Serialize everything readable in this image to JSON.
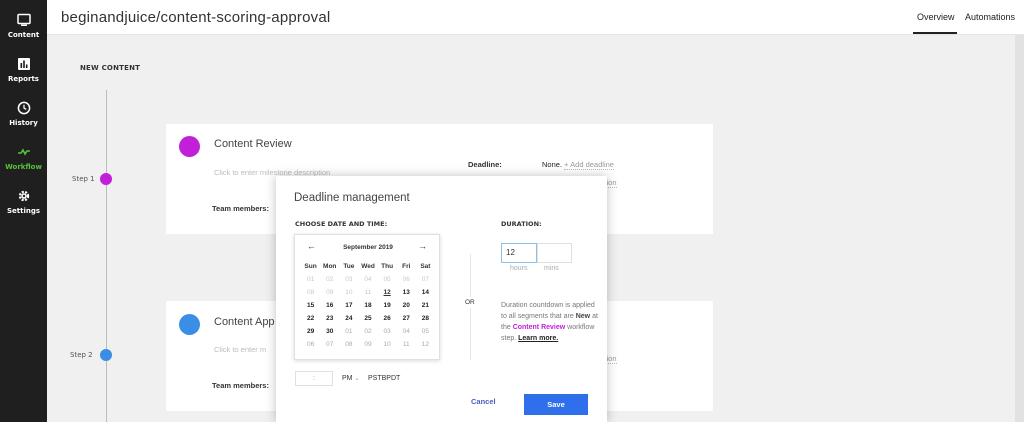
{
  "sidebar": {
    "items": [
      {
        "label": "Content",
        "icon": "monitor-icon"
      },
      {
        "label": "Reports",
        "icon": "bar-chart-icon"
      },
      {
        "label": "History",
        "icon": "clock-icon"
      },
      {
        "label": "Workflow",
        "icon": "workflow-icon",
        "active": true
      },
      {
        "label": "Settings",
        "icon": "gear-icon"
      }
    ]
  },
  "header": {
    "title": "beginandjuice/content-scoring-approval",
    "tabs": [
      "Overview",
      "Automations"
    ],
    "active_tab": "Overview"
  },
  "main": {
    "section_label": "NEW CONTENT",
    "steps": [
      {
        "label": "Step 1",
        "color": "#c21fd9",
        "title": "Content Review",
        "desc": "Click to enter milestone description",
        "team_label": "Team members:",
        "deadline_label": "Deadline:",
        "deadline_value": "None.",
        "add_deadline": "+ Add deadline",
        "automation": "mation"
      },
      {
        "label": "Step 2",
        "color": "#3a8ee6",
        "title": "Content App",
        "desc": "Click to enter m",
        "team_label": "Team members:",
        "deadline_label": "",
        "deadline_value": "",
        "add_deadline": "line",
        "automation": "mation"
      }
    ]
  },
  "modal": {
    "title": "Deadline management",
    "choose_label": "CHOOSE DATE AND TIME:",
    "duration_label": "DURATION:",
    "calendar": {
      "prev": "←",
      "next": "→",
      "month": "September 2019",
      "weekdays": [
        "Sun",
        "Mon",
        "Tue",
        "Wed",
        "Thu",
        "Fri",
        "Sat"
      ],
      "days": [
        {
          "n": "01",
          "s": "past"
        },
        {
          "n": "02",
          "s": "past"
        },
        {
          "n": "03",
          "s": "past"
        },
        {
          "n": "04",
          "s": "past"
        },
        {
          "n": "05",
          "s": "past"
        },
        {
          "n": "06",
          "s": "past"
        },
        {
          "n": "07",
          "s": "past"
        },
        {
          "n": "08",
          "s": "past"
        },
        {
          "n": "09",
          "s": "past"
        },
        {
          "n": "10",
          "s": "past"
        },
        {
          "n": "11",
          "s": "past"
        },
        {
          "n": "12",
          "s": "today"
        },
        {
          "n": "13",
          "s": "cur"
        },
        {
          "n": "14",
          "s": "cur"
        },
        {
          "n": "15",
          "s": "cur"
        },
        {
          "n": "16",
          "s": "cur"
        },
        {
          "n": "17",
          "s": "cur"
        },
        {
          "n": "18",
          "s": "cur"
        },
        {
          "n": "19",
          "s": "cur"
        },
        {
          "n": "20",
          "s": "cur"
        },
        {
          "n": "21",
          "s": "cur"
        },
        {
          "n": "22",
          "s": "cur"
        },
        {
          "n": "23",
          "s": "cur"
        },
        {
          "n": "24",
          "s": "cur"
        },
        {
          "n": "25",
          "s": "cur"
        },
        {
          "n": "26",
          "s": "cur"
        },
        {
          "n": "27",
          "s": "cur"
        },
        {
          "n": "28",
          "s": "cur"
        },
        {
          "n": "29",
          "s": "cur"
        },
        {
          "n": "30",
          "s": "cur"
        },
        {
          "n": "01",
          "s": "next"
        },
        {
          "n": "02",
          "s": "next"
        },
        {
          "n": "03",
          "s": "next"
        },
        {
          "n": "04",
          "s": "next"
        },
        {
          "n": "05",
          "s": "next"
        },
        {
          "n": "06",
          "s": "next"
        },
        {
          "n": "07",
          "s": "next"
        },
        {
          "n": "08",
          "s": "next"
        },
        {
          "n": "09",
          "s": "next"
        },
        {
          "n": "10",
          "s": "next"
        },
        {
          "n": "11",
          "s": "next"
        },
        {
          "n": "12",
          "s": "next"
        }
      ]
    },
    "time_value": ":",
    "ampm": "PM",
    "timezone": "PSTBPDT",
    "or_label": "OR",
    "hours_value": "12",
    "hours_label": "hours",
    "mins_label": "mins",
    "info": {
      "part1": "Duration countdown is applied to all segments that are",
      "new": "New",
      "part2": "at the",
      "step": "Content Review",
      "part3": "workflow step.",
      "learn_more": "Learn more."
    },
    "cancel_label": "Cancel",
    "save_label": "Save"
  },
  "colors": {
    "sidebar_bg": "#1f1f1f",
    "active_green": "#55c23d",
    "purple": "#c21fd9",
    "blue": "#3a8ee6",
    "save_button": "#2f6fec"
  }
}
